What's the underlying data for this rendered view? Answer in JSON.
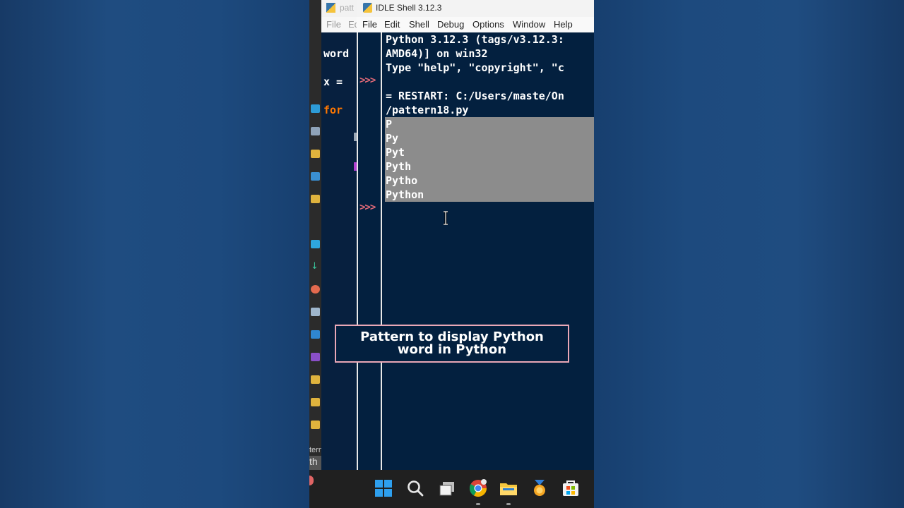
{
  "editor": {
    "title_fragment": "patt",
    "menu": [
      "File",
      "Ed"
    ],
    "code_lines": [
      "word",
      "x = ",
      "for "
    ]
  },
  "shell": {
    "title": "IDLE Shell 3.12.3",
    "menu": [
      "File",
      "Edit",
      "Shell",
      "Debug",
      "Options",
      "Window",
      "Help"
    ],
    "prompt": ">>>",
    "banner": [
      "Python 3.12.3 (tags/v3.12.3:",
      "AMD64)] on win32",
      "Type \"help\", \"copyright\", \"c"
    ],
    "restart": [
      "= RESTART: C:/Users/maste/On",
      "/pattern18.py"
    ],
    "output": [
      "P",
      "Py",
      "Pyt",
      "Pyth",
      "Pytho",
      "Python"
    ]
  },
  "left_strip": {
    "labels": [
      "tern",
      "th"
    ]
  },
  "caption": {
    "line1": "Pattern to display Python",
    "line2": "word in Python"
  },
  "taskbar": {
    "icons": [
      "start-icon",
      "search-icon",
      "task-view-icon",
      "chrome-icon",
      "file-explorer-icon",
      "award-app-icon",
      "store-icon"
    ]
  },
  "colors": {
    "shell_bg": "#03203f",
    "prompt": "#e36a78",
    "selection": "#8c8c8c",
    "caption_border": "#e9a7b6",
    "keyword": "#ff7700"
  }
}
